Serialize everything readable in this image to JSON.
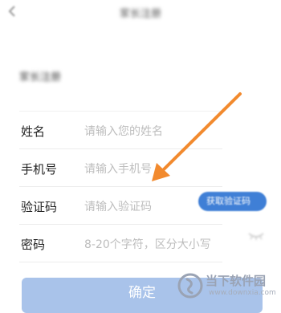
{
  "header": {
    "back_icon": "back-arrow-icon",
    "title": "家长注册"
  },
  "section": {
    "title": "家长注册"
  },
  "form": {
    "rows": [
      {
        "label": "姓名",
        "placeholder": "请输入您的姓名"
      },
      {
        "label": "手机号",
        "placeholder": "请输入手机号"
      },
      {
        "label": "验证码",
        "placeholder": "请输入验证码"
      },
      {
        "label": "密码",
        "placeholder": "8-20个字符，区分大小写"
      }
    ],
    "get_code_label": "获取验证码",
    "password_toggle_icon": "eye-closed-icon"
  },
  "confirm_label": "确定",
  "annotation": {
    "arrow_color": "#f28a2e",
    "points_to": "验证码"
  },
  "watermark": {
    "text": "当下软件园",
    "url": "www.downxia.com"
  },
  "colors": {
    "primary": "#3f7fd6",
    "confirm_button": "#a9c3ea",
    "placeholder": "#bdbdbd"
  }
}
